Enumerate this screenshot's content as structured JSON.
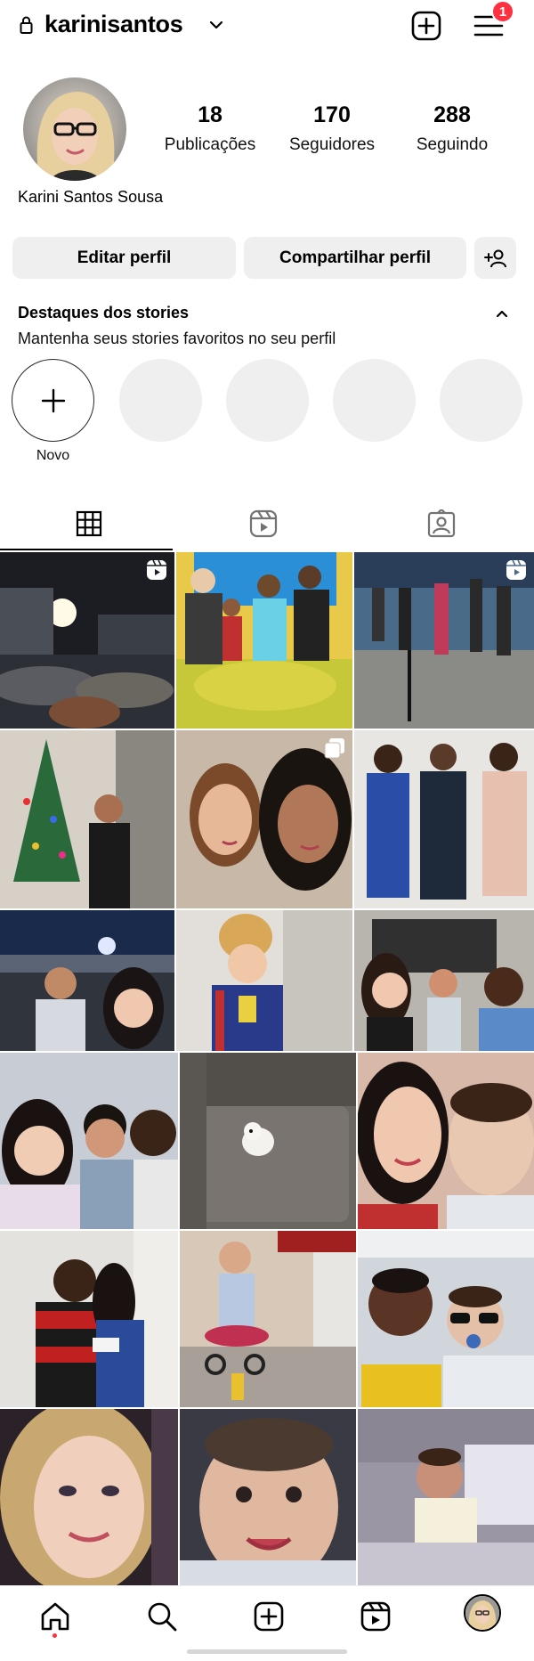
{
  "header": {
    "username": "karinisantos",
    "icons": [
      "lock-icon",
      "chevron-down-icon",
      "add-post-icon",
      "menu-icon"
    ],
    "notification_count": "1",
    "accent": "#ff3040"
  },
  "profile": {
    "stats": [
      {
        "value": "18",
        "label": "Publicações"
      },
      {
        "value": "170",
        "label": "Seguidores"
      },
      {
        "value": "288",
        "label": "Seguindo"
      }
    ],
    "full_name": "Karini Santos Sousa"
  },
  "actions": {
    "edit_label": "Editar perfil",
    "share_label": "Compartilhar perfil",
    "add_user_icon": "add-user-icon"
  },
  "highlights": {
    "title": "Destaques dos stories",
    "subtitle": "Mantenha seus stories favoritos no seu perfil",
    "new_label": "Novo"
  },
  "tabs": [
    "grid-icon",
    "reels-icon",
    "tagged-icon"
  ],
  "grid": {
    "count": 18,
    "badges": [
      "reel-badge-icon",
      "multiple-badge-icon"
    ]
  },
  "bottom_nav": [
    "home-icon",
    "search-icon",
    "create-icon",
    "reels-icon",
    "profile-avatar"
  ]
}
